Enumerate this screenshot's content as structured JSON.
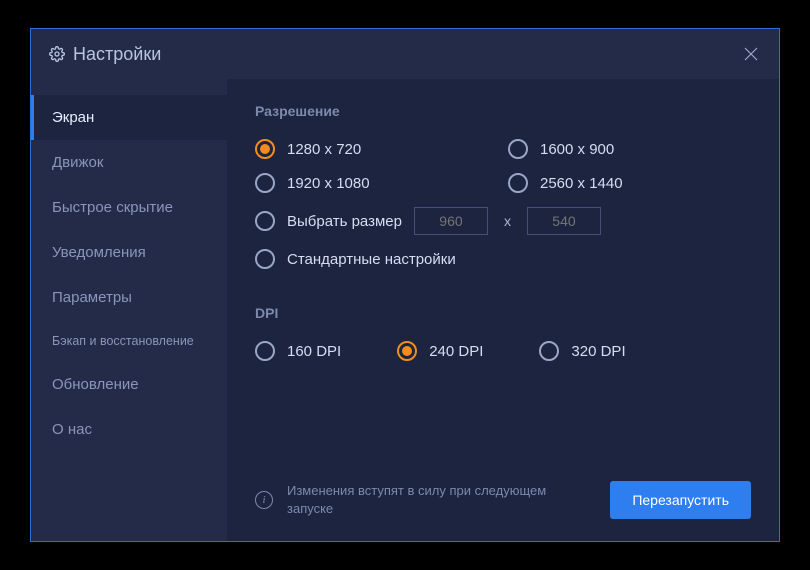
{
  "window": {
    "title": "Настройки"
  },
  "sidebar": {
    "items": [
      {
        "label": "Экран",
        "active": true
      },
      {
        "label": "Движок",
        "active": false
      },
      {
        "label": "Быстрое скрытие",
        "active": false
      },
      {
        "label": "Уведомления",
        "active": false
      },
      {
        "label": "Параметры",
        "active": false
      },
      {
        "label": "Бэкап и восстановление",
        "active": false,
        "small": true
      },
      {
        "label": "Обновление",
        "active": false
      },
      {
        "label": "О нас",
        "active": false
      }
    ]
  },
  "resolution": {
    "title": "Разрешение",
    "options": [
      {
        "label": "1280 x 720",
        "selected": true
      },
      {
        "label": "1600 x 900",
        "selected": false
      },
      {
        "label": "1920 x 1080",
        "selected": false
      },
      {
        "label": "2560 x 1440",
        "selected": false
      }
    ],
    "custom": {
      "label": "Выбрать размер",
      "width_placeholder": "960",
      "height_placeholder": "540",
      "separator": "x"
    },
    "default_label": "Стандартные настройки"
  },
  "dpi": {
    "title": "DPI",
    "options": [
      {
        "label": "160 DPI",
        "selected": false
      },
      {
        "label": "240 DPI",
        "selected": true
      },
      {
        "label": "320 DPI",
        "selected": false
      }
    ]
  },
  "footer": {
    "info_text": "Изменения вступят в силу при следующем запуске",
    "restart_label": "Перезапустить"
  },
  "colors": {
    "accent_orange": "#f28c1a",
    "accent_blue": "#2f7ef0",
    "bg_dark": "#1c2440",
    "bg_sidebar": "#232b48"
  }
}
